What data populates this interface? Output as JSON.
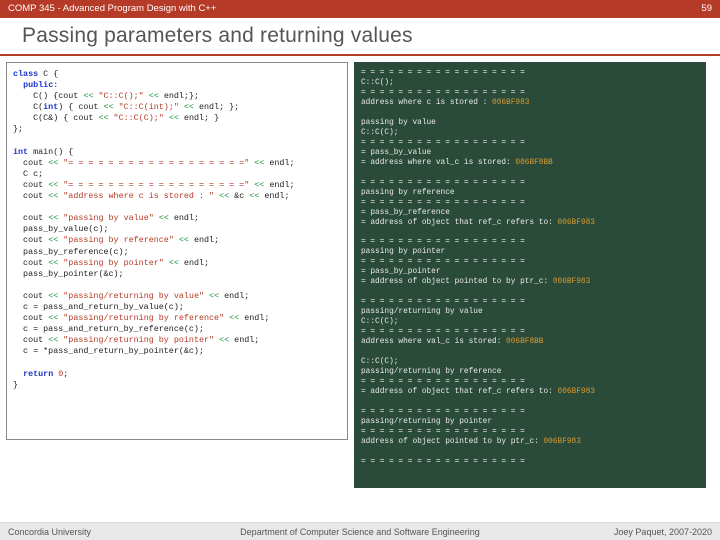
{
  "header": {
    "course": "COMP 345 - Advanced Program Design with C++",
    "page": "59"
  },
  "title": "Passing parameters and returning values",
  "code": {
    "class_kw": "class",
    "class_name": " C {",
    "public_kw": "public",
    "public_colon": ":",
    "ctor0_a": "    C() {cout ",
    "ctor0_b": "<<",
    "ctor0_c": " ",
    "ctor0_s": "\"C::C();\"",
    "ctor0_d": " ",
    "ctor0_e": "<<",
    "ctor0_f": " endl;};",
    "ctor1_a": "    C(",
    "ctor1_int": "int",
    "ctor1_b": ") { cout ",
    "ctor1_op1": "<<",
    "ctor1_sp1": " ",
    "ctor1_s": "\"C::C(int);\"",
    "ctor1_sp2": " ",
    "ctor1_op2": "<<",
    "ctor1_c": " endl; };",
    "ctor2_a": "    C(C&) { cout ",
    "ctor2_op1": "<<",
    "ctor2_sp1": " ",
    "ctor2_s": "\"C::C(C);\"",
    "ctor2_sp2": " ",
    "ctor2_op2": "<<",
    "ctor2_c": " endl; }",
    "class_end": "};",
    "main_int": "int",
    "main_sig": " main() {",
    "m1_a": "  cout ",
    "m1_op1": "<<",
    "m1_sp": " ",
    "m1_s": "\"= = = = = = = = = = = = = = = = = =\"",
    "m1_sp2": " ",
    "m1_op2": "<<",
    "m1_b": " endl;",
    "m2": "  C c;",
    "m3_a": "  cout ",
    "m3_op1": "<<",
    "m3_s": "\"= = = = = = = = = = = = = = = = = =\"",
    "m3_op2": "<<",
    "m3_b": " endl;",
    "m4_a": "  cout ",
    "m4_op1": "<<",
    "m4_s": "\"address where c is stored : \"",
    "m4_op2": "<<",
    "m4_b": " &c ",
    "m4_op3": "<<",
    "m4_c": " endl;",
    "m5_a": "  cout ",
    "m5_op": "<<",
    "m5_s": "\"passing by value\"",
    "m5_op2": "<<",
    "m5_b": " endl;",
    "m6": "  pass_by_value(c);",
    "m7_a": "  cout ",
    "m7_op": "<<",
    "m7_s": "\"passing by reference\"",
    "m7_op2": "<<",
    "m7_b": " endl;",
    "m8": "  pass_by_reference(c);",
    "m9_a": "  cout ",
    "m9_op": "<<",
    "m9_s": "\"passing by pointer\"",
    "m9_op2": "<<",
    "m9_b": " endl;",
    "m10": "  pass_by_pointer(&c);",
    "m11_a": "  cout ",
    "m11_op": "<<",
    "m11_s": "\"passing/returning by value\"",
    "m11_op2": "<<",
    "m11_b": " endl;",
    "m12": "  c = pass_and_return_by_value(c);",
    "m13_a": "  cout ",
    "m13_op": "<<",
    "m13_s": "\"passing/returning by reference\"",
    "m13_op2": "<<",
    "m13_b": " endl;",
    "m14": "  c = pass_and_return_by_reference(c);",
    "m15_a": "  cout ",
    "m15_op": "<<",
    "m15_s": "\"passing/returning by pointer\"",
    "m15_op2": "<<",
    "m15_b": " endl;",
    "m16": "  c = *pass_and_return_by_pointer(&c);",
    "ret_kw": "return",
    "ret_sp": " ",
    "ret_num": "0",
    "ret_semi": ";",
    "main_end": "}"
  },
  "out": {
    "l1": "= = = = = = = = = = = = = = = = = =",
    "l2": "C::C();",
    "l3": "= = = = = = = = = = = = = = = = = =",
    "l4a": "address where c is stored : ",
    "addr1": "006BF983",
    "l5": "passing by value",
    "l6": "C::C(C);",
    "l7": "= = = = = = = = = = = = = = = = = =",
    "l8": "= pass_by_value",
    "l9a": "= address where val_c is stored: ",
    "addr2": "006BF8BB",
    "l10": "= = = = = = = = = = = = = = = = = =",
    "l11": "passing by reference",
    "l12": "= = = = = = = = = = = = = = = = = =",
    "l13": "= pass_by_reference",
    "l14a": "= address of object that ref_c refers to: ",
    "addr3": "006BF983",
    "l15": "= = = = = = = = = = = = = = = = = =",
    "l16": "passing by pointer",
    "l17": "= = = = = = = = = = = = = = = = = =",
    "l18": "= pass_by_pointer",
    "l19a": "= address of object pointed to by ptr_c: ",
    "addr4": "006BF983",
    "l20": "= = = = = = = = = = = = = = = = = =",
    "l21": "passing/returning by value",
    "l22": "C::C(C);",
    "l23": "= = = = = = = = = = = = = = = = = =",
    "l24a": "address where val_c is stored: ",
    "addr5": "006BF8BB",
    "l25": "C::C(C);",
    "l26": "passing/returning by reference",
    "l27": "= = = = = = = = = = = = = = = = = =",
    "l28a": "= address of object that ref_c refers to: ",
    "addr6": "006BF983",
    "l29": "= = = = = = = = = = = = = = = = = =",
    "l30": "passing/returning by pointer",
    "l31": "= = = = = = = = = = = = = = = = = =",
    "l32a": "address of object pointed to by ptr_c: ",
    "addr7": "006BF983",
    "l33": "= = = = = = = = = = = = = = = = = ="
  },
  "footer": {
    "left": "Concordia University",
    "mid": "Department of Computer Science and Software Engineering",
    "right": "Joey Paquet, 2007-2020"
  }
}
